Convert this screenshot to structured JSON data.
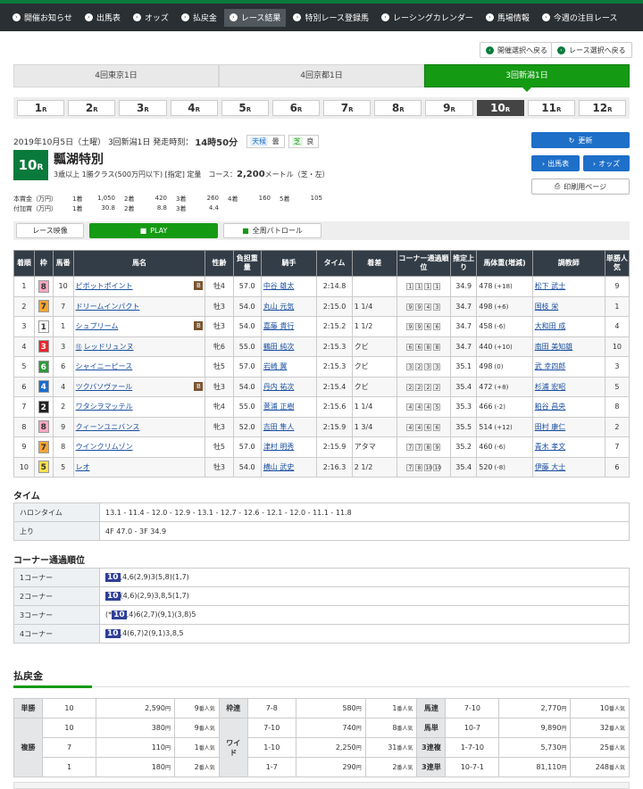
{
  "nav": [
    "開催お知らせ",
    "出馬表",
    "オッズ",
    "払戻金",
    "レース結果",
    "特別レース登録馬",
    "レーシングカレンダー",
    "馬場情報",
    "今週の注目レース"
  ],
  "nav_active": 4,
  "back_buttons": {
    "kaisai": "開催選択へ戻る",
    "race": "レース選択へ戻る"
  },
  "venues": [
    "4回東京1日",
    "4回京都1日",
    "3回新潟1日"
  ],
  "venue_active": 2,
  "races": [
    {
      "n": "1",
      "r": "R"
    },
    {
      "n": "2",
      "r": "R"
    },
    {
      "n": "3",
      "r": "R"
    },
    {
      "n": "4",
      "r": "R"
    },
    {
      "n": "5",
      "r": "R"
    },
    {
      "n": "6",
      "r": "R"
    },
    {
      "n": "7",
      "r": "R"
    },
    {
      "n": "8",
      "r": "R"
    },
    {
      "n": "9",
      "r": "R"
    },
    {
      "n": "10",
      "r": "R"
    },
    {
      "n": "11",
      "r": "R"
    },
    {
      "n": "12",
      "r": "R"
    }
  ],
  "race_active": 9,
  "meta": {
    "date": "2019年10月5日（土曜） 3回新潟1日 発走時刻：",
    "time": "14時50分",
    "weather_label": "天候",
    "weather": "曇",
    "turf_label": "芝",
    "turf": "良"
  },
  "race": {
    "num": "10",
    "r": "R",
    "name": "瓢湖特別",
    "cond": "3歳以上 1勝クラス(500万円以下) [指定] 定量　コース：",
    "dist": "2,200",
    "dist_unit": "メートル（芝・左）"
  },
  "buttons": {
    "refresh": "更新",
    "card": "出馬表",
    "odds": "オッズ",
    "print": "印刷用ページ"
  },
  "prize": {
    "main_label": "本賞金（万円）",
    "main": [
      "1着",
      "1,050",
      "2着",
      "420",
      "3着",
      "260",
      "4着",
      "160",
      "5着",
      "105"
    ],
    "add_label": "付加賞（万円）",
    "add": [
      "1着",
      "30.8",
      "2着",
      "8.8",
      "3着",
      "4.4"
    ]
  },
  "video": {
    "label": "レース映像",
    "play": "PLAY",
    "patrol": "全周パトロール"
  },
  "headers": [
    "着順",
    "枠",
    "馬番",
    "馬名",
    "性齢",
    "負担重量",
    "騎手",
    "タイム",
    "着差",
    "コーナー通過順位",
    "推定上り",
    "馬体重(増減)",
    "調教師",
    "単勝人気"
  ],
  "rows": [
    {
      "pos": "1",
      "waku": "8",
      "num": "10",
      "name": "ピボットポイント",
      "b": true,
      "sex": "牡4",
      "wt": "57.0",
      "jockey": "中谷 雄太",
      "time": "2:14.8",
      "margin": "",
      "corner": [
        "1",
        "1",
        "1",
        "1"
      ],
      "last": "34.9",
      "bw": "478",
      "bwd": "(+18)",
      "trainer": "松下 武士",
      "pop": "9"
    },
    {
      "pos": "2",
      "waku": "7",
      "num": "7",
      "name": "ドリームインパクト",
      "b": false,
      "sex": "牡3",
      "wt": "54.0",
      "jockey": "丸山 元気",
      "time": "2:15.0",
      "margin": "1 1/4",
      "corner": [
        "9",
        "9",
        "4",
        "3"
      ],
      "last": "34.7",
      "bw": "498",
      "bwd": "(+6)",
      "trainer": "国枝 栄",
      "pop": "1"
    },
    {
      "pos": "3",
      "waku": "1",
      "num": "1",
      "name": "シュプリーム",
      "b": true,
      "sex": "牡3",
      "wt": "54.0",
      "jockey": "嘉藤 貴行",
      "time": "2:15.2",
      "margin": "1 1/2",
      "corner": [
        "9",
        "9",
        "6",
        "6"
      ],
      "last": "34.7",
      "bw": "458",
      "bwd": "(-6)",
      "trainer": "大和田 成",
      "pop": "4"
    },
    {
      "pos": "4",
      "waku": "3",
      "num": "3",
      "name": "レッドリュンヌ",
      "b": false,
      "mark": "⑮",
      "sex": "牝6",
      "wt": "55.0",
      "jockey": "鶴田 純次",
      "time": "2:15.3",
      "margin": "クビ",
      "corner": [
        "6",
        "6",
        "8",
        "8"
      ],
      "last": "34.7",
      "bw": "440",
      "bwd": "(+10)",
      "trainer": "南田 美知雄",
      "pop": "10"
    },
    {
      "pos": "5",
      "waku": "6",
      "num": "6",
      "name": "シャイニーピース",
      "b": false,
      "sex": "牡5",
      "wt": "57.0",
      "jockey": "岩崎 翼",
      "time": "2:15.3",
      "margin": "クビ",
      "corner": [
        "3",
        "2",
        "3",
        "3"
      ],
      "last": "35.1",
      "bw": "498",
      "bwd": "(0)",
      "trainer": "武 幸四郎",
      "pop": "3"
    },
    {
      "pos": "6",
      "waku": "4",
      "num": "4",
      "name": "ツクバソヴァール",
      "b": true,
      "sex": "牡3",
      "wt": "54.0",
      "jockey": "丹内 祐次",
      "time": "2:15.4",
      "margin": "クビ",
      "corner": [
        "2",
        "2",
        "2",
        "2"
      ],
      "last": "35.4",
      "bw": "472",
      "bwd": "(+8)",
      "trainer": "杉浦 宏昭",
      "pop": "5"
    },
    {
      "pos": "7",
      "waku": "2",
      "num": "2",
      "name": "ワタシヲマッテル",
      "b": false,
      "sex": "牝4",
      "wt": "55.0",
      "jockey": "菅浦 正樹",
      "time": "2:15.6",
      "margin": "1 1/4",
      "corner": [
        "4",
        "4",
        "4",
        "5"
      ],
      "last": "35.3",
      "bw": "466",
      "bwd": "(-2)",
      "trainer": "粕谷 昌央",
      "pop": "8"
    },
    {
      "pos": "8",
      "waku": "8",
      "num": "9",
      "name": "クィーンユニバンス",
      "b": false,
      "sex": "牝3",
      "wt": "52.0",
      "jockey": "吉田 隼人",
      "time": "2:15.9",
      "margin": "1 3/4",
      "corner": [
        "4",
        "4",
        "6",
        "6"
      ],
      "last": "35.5",
      "bw": "514",
      "bwd": "(+12)",
      "trainer": "田村 康仁",
      "pop": "2"
    },
    {
      "pos": "9",
      "waku": "7",
      "num": "8",
      "name": "ウインクリムゾン",
      "b": false,
      "sex": "牡5",
      "wt": "57.0",
      "jockey": "津村 明秀",
      "time": "2:15.9",
      "margin": "アタマ",
      "corner": [
        "7",
        "7",
        "8",
        "9"
      ],
      "last": "35.2",
      "bw": "460",
      "bwd": "(-6)",
      "trainer": "青木 孝文",
      "pop": "7"
    },
    {
      "pos": "10",
      "waku": "5",
      "num": "5",
      "name": "レオ",
      "b": false,
      "sex": "牡3",
      "wt": "54.0",
      "jockey": "横山 武史",
      "time": "2:16.3",
      "margin": "2 1/2",
      "corner": [
        "7",
        "8",
        "10",
        "10"
      ],
      "last": "35.4",
      "bw": "520",
      "bwd": "(-8)",
      "trainer": "伊藤 大士",
      "pop": "6"
    }
  ],
  "time_section": {
    "title": "タイム",
    "furlong_label": "ハロンタイム",
    "furlong": "13.1 - 11.4 - 12.0 - 12.9 - 13.1 - 12.7 - 12.6 - 12.1 - 12.0 - 11.1 - 11.8",
    "agari_label": "上り",
    "agari": "4F 47.0 - 3F 34.9"
  },
  "corner_section": {
    "title": "コーナー通過順位",
    "rows": [
      {
        "label": "1コーナー",
        "pre": "",
        "lead": "10",
        "rest": ",4,6(2,9)3(5,8)(1,7)"
      },
      {
        "label": "2コーナー",
        "pre": "",
        "lead": "10",
        "rest": "(4,6)(2,9)3,8,5(1,7)"
      },
      {
        "label": "3コーナー",
        "pre": "(*",
        "lead": "10",
        "rest": ",4)6(2,7)(9,1)(3,8)5"
      },
      {
        "label": "4コーナー",
        "pre": "",
        "lead": "10",
        "rest": ",4(6,7)2(9,1)3,8,5"
      }
    ]
  },
  "payout_title": "払戻金",
  "payout": {
    "tansho": {
      "label": "単勝",
      "rows": [
        {
          "num": "10",
          "yen": "2,590",
          "unit": "円",
          "pop": "9",
          "popu": "番人気"
        }
      ]
    },
    "fukusho": {
      "label": "複勝",
      "rows": [
        {
          "num": "10",
          "yen": "380",
          "unit": "円",
          "pop": "9",
          "popu": "番人気"
        },
        {
          "num": "7",
          "yen": "110",
          "unit": "円",
          "pop": "1",
          "popu": "番人気"
        },
        {
          "num": "1",
          "yen": "180",
          "unit": "円",
          "pop": "2",
          "popu": "番人気"
        }
      ]
    },
    "wakuren": {
      "label": "枠連",
      "rows": [
        {
          "num": "7-8",
          "yen": "580",
          "unit": "円",
          "pop": "1",
          "popu": "番人気"
        }
      ]
    },
    "wide": {
      "label": "ワイド",
      "rows": [
        {
          "num": "7-10",
          "yen": "740",
          "unit": "円",
          "pop": "8",
          "popu": "番人気"
        },
        {
          "num": "1-10",
          "yen": "2,250",
          "unit": "円",
          "pop": "31",
          "popu": "番人気"
        },
        {
          "num": "1-7",
          "yen": "290",
          "unit": "円",
          "pop": "2",
          "popu": "番人気"
        }
      ]
    },
    "umaren": {
      "label": "馬連",
      "rows": [
        {
          "num": "7-10",
          "yen": "2,770",
          "unit": "円",
          "pop": "10",
          "popu": "番人気"
        }
      ]
    },
    "umatan": {
      "label": "馬単",
      "rows": [
        {
          "num": "10-7",
          "yen": "9,890",
          "unit": "円",
          "pop": "32",
          "popu": "番人気"
        }
      ]
    },
    "sanrenpuku": {
      "label": "3連複",
      "rows": [
        {
          "num": "1-7-10",
          "yen": "5,730",
          "unit": "円",
          "pop": "25",
          "popu": "番人気"
        }
      ]
    },
    "sanrentan": {
      "label": "3連単",
      "rows": [
        {
          "num": "10-7-1",
          "yen": "81,110",
          "unit": "円",
          "pop": "248",
          "popu": "番人気"
        }
      ]
    }
  },
  "colors": {
    "green": "#159a14",
    "blue": "#1e6fc8",
    "header": "#333d47",
    "waku1": "#ffffff",
    "waku2": "#222222",
    "waku3": "#e8262a",
    "waku4": "#1b6cd1",
    "waku5": "#f8e04b",
    "waku6": "#2d9a3a",
    "waku7": "#f3a532",
    "waku8": "#f6a7c1"
  }
}
